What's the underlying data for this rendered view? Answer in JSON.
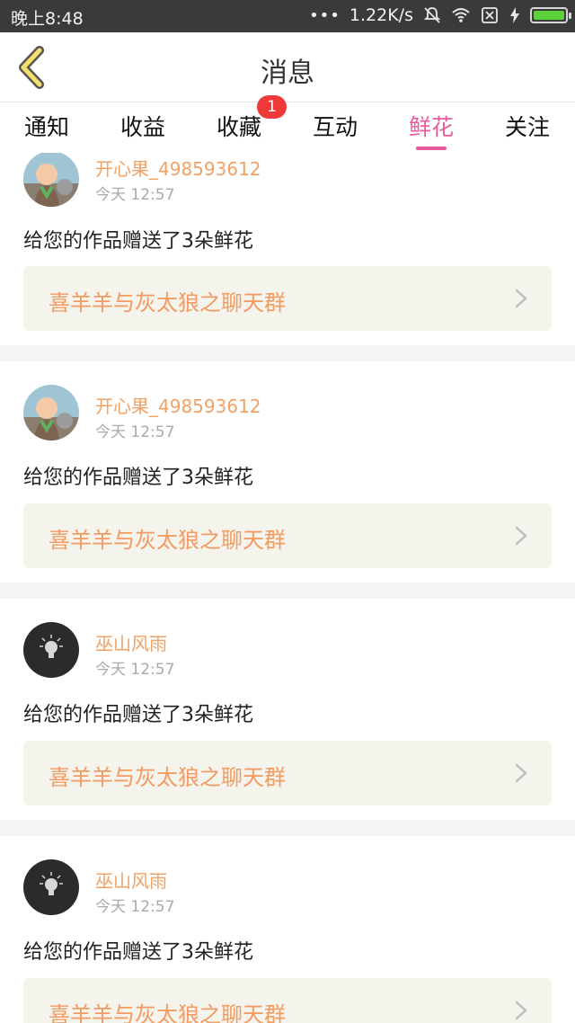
{
  "status_bar": {
    "time": "晚上8:48",
    "dots": "•••",
    "speed": "1.22K/s",
    "icons": [
      "notifications-off-icon",
      "wifi-icon",
      "sim-off-icon",
      "charging-icon",
      "battery-icon"
    ]
  },
  "header": {
    "title": "消息",
    "back_icon": "back-chevron-icon"
  },
  "tabs": {
    "items": [
      "通知",
      "收益",
      "收藏",
      "互动",
      "鲜花",
      "关注"
    ],
    "active": "鲜花",
    "badge": "1",
    "accent_color": "#e95b9a"
  },
  "feed": {
    "items": [
      {
        "user": "开心果_498593612",
        "time": "今天 12:57",
        "message": "给您的作品赠送了3朵鲜花",
        "group": "喜羊羊与灰太狼之聊天群",
        "avatar": "child-photo-avatar"
      },
      {
        "user": "开心果_498593612",
        "time": "今天 12:57",
        "message": "给您的作品赠送了3朵鲜花",
        "group": "喜羊羊与灰太狼之聊天群",
        "avatar": "child-photo-avatar"
      },
      {
        "user": "巫山风雨",
        "time": "今天 12:57",
        "message": "给您的作品赠送了3朵鲜花",
        "group": "喜羊羊与灰太狼之聊天群",
        "avatar": "lightbulb-avatar"
      },
      {
        "user": "巫山风雨",
        "time": "今天 12:57",
        "message": "给您的作品赠送了3朵鲜花",
        "group": "喜羊羊与灰太狼之聊天群",
        "avatar": "lightbulb-avatar"
      }
    ]
  },
  "colors": {
    "username": "#f0a265",
    "group_link_text": "#f29b62",
    "group_link_bg": "#f4f3ec",
    "badge": "#f03a3a",
    "status_bar_bg": "#3a3a3a",
    "back_icon_fill": "#f5e06a"
  }
}
